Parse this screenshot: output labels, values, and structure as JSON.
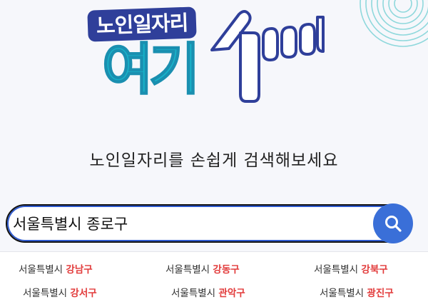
{
  "logo": {
    "top_text": "노인일자리",
    "main_text": "여기",
    "colors": {
      "navy": "#2f3f9a",
      "teal": "#18b2c9"
    }
  },
  "tagline": "노인일자리를 손쉽게 검색해보세요",
  "search": {
    "value": "서울특별시 종로구",
    "button_icon": "search-icon",
    "button_color": "#3a6fd8"
  },
  "quick_links": [
    {
      "city": "서울특별시",
      "district": "강남구"
    },
    {
      "city": "서울특별시",
      "district": "강동구"
    },
    {
      "city": "서울특별시",
      "district": "강북구"
    },
    {
      "city": "서울특별시",
      "district": "강서구"
    },
    {
      "city": "서울특별시",
      "district": "관악구"
    },
    {
      "city": "서울특별시",
      "district": "광진구"
    }
  ],
  "accent_color": "#e23b3b"
}
